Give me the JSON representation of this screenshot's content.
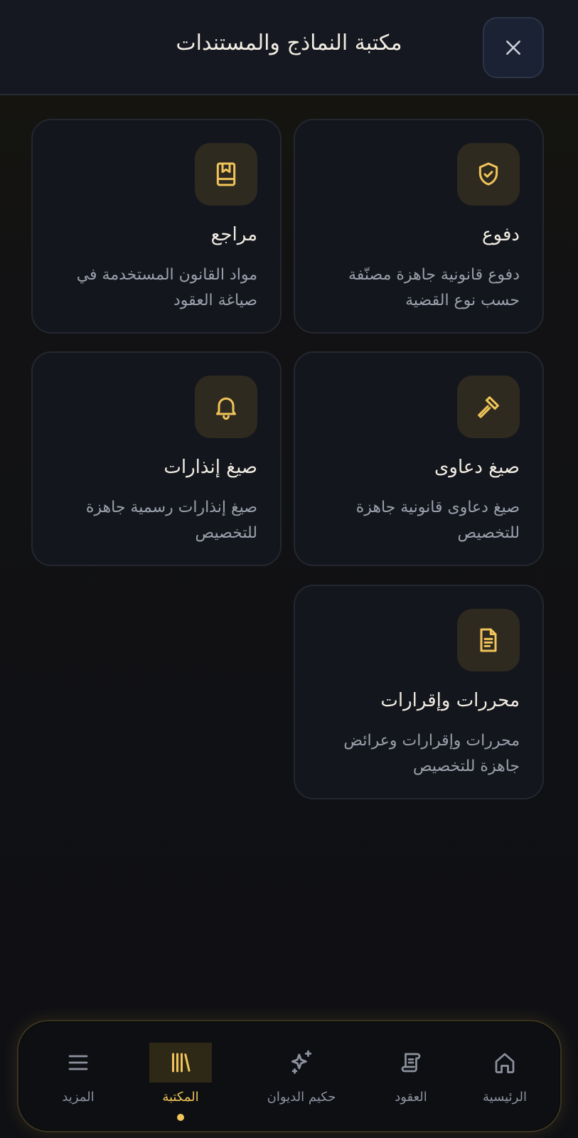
{
  "header": {
    "title": "مكتبة النماذج والمستندات",
    "close_icon": "close-icon"
  },
  "cards": [
    {
      "title": "دفوع",
      "description": "دفوع قانونية جاهزة مصنّفة حسب نوع القضية",
      "icon": "shield-check-icon"
    },
    {
      "title": "مراجع",
      "description": "مواد القانون المستخدمة في صياغة العقود",
      "icon": "bookmark-book-icon"
    },
    {
      "title": "صيغ دعاوى",
      "description": "صيغ دعاوى قانونية جاهزة للتخصيص",
      "icon": "gavel-icon"
    },
    {
      "title": "صيغ إنذارات",
      "description": "صيغ إنذارات رسمية جاهزة للتخصيص",
      "icon": "bell-icon"
    },
    {
      "title": "محررات وإقرارات",
      "description": "محررات وإقرارات وعرائض جاهزة للتخصيص",
      "icon": "document-icon"
    }
  ],
  "nav": {
    "items": [
      {
        "label": "الرئيسية",
        "icon": "home-icon"
      },
      {
        "label": "العقود",
        "icon": "scroll-icon"
      },
      {
        "label": "حكيم الديوان",
        "icon": "sparkles-icon"
      },
      {
        "label": "المكتبة",
        "icon": "library-icon",
        "active": true
      },
      {
        "label": "المزيد",
        "icon": "menu-icon"
      }
    ]
  },
  "colors": {
    "accent": "#f0c45a",
    "background": "#101116",
    "card": "#14161d",
    "muted_text": "#9aa0ac"
  }
}
